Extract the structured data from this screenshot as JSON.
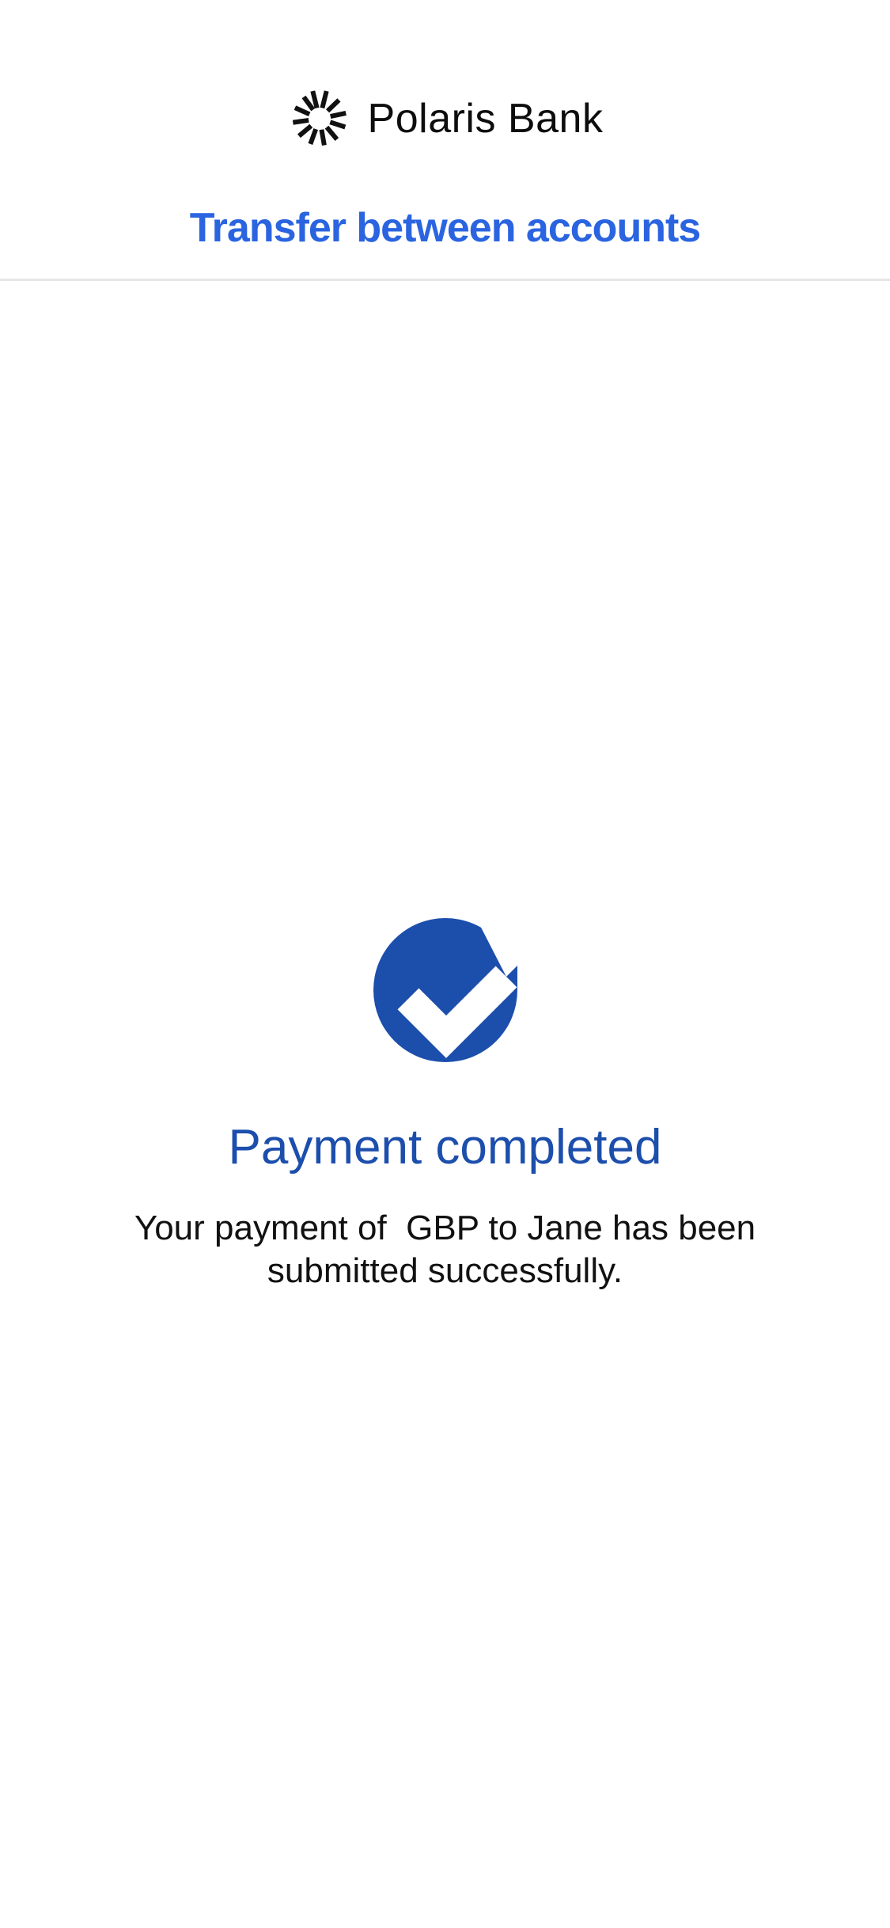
{
  "header": {
    "brand_name": "Polaris Bank",
    "brand_icon": "sunburst-logo-icon",
    "page_title": "Transfer between accounts"
  },
  "confirmation": {
    "icon": "check-circle-icon",
    "title": "Payment completed",
    "message": "Your payment of  GBP to Jane has been submitted successfully."
  },
  "colors": {
    "accent": "#2a64e0",
    "success_blue": "#1c4eac",
    "text": "#111111",
    "divider": "#e6e6e9"
  }
}
